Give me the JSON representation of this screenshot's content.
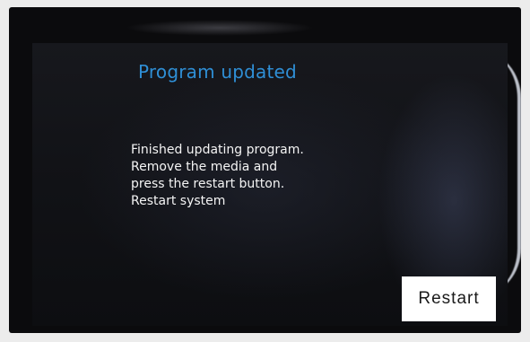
{
  "screen": {
    "title": "Program updated",
    "message_lines": [
      "Finished updating program.",
      "Remove the media and",
      "press the restart button.",
      "Restart system"
    ]
  },
  "actions": {
    "restart_label": "Restart"
  },
  "colors": {
    "title": "#2f8fd6",
    "background": "#111216",
    "message_text": "#f4f4f4",
    "button_bg": "#ffffff"
  }
}
